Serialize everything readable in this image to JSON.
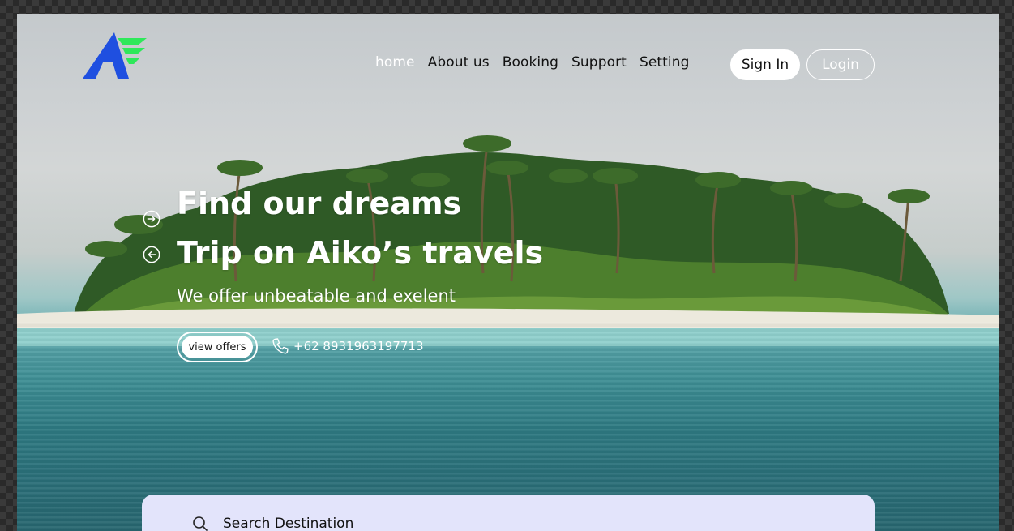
{
  "nav": {
    "items": [
      {
        "label": "home",
        "active": true
      },
      {
        "label": "About us",
        "active": false
      },
      {
        "label": "Booking",
        "active": false
      },
      {
        "label": "Support",
        "active": false
      },
      {
        "label": "Setting",
        "active": false
      }
    ]
  },
  "auth": {
    "signin_label": "Sign In",
    "login_label": "Login"
  },
  "hero": {
    "title_line1": "Find our dreams",
    "title_line2": "Trip on Aiko’s travels",
    "subtitle": "We offer unbeatable and exelent",
    "offers_label": "view offers",
    "phone": "+62 8931963197713"
  },
  "search": {
    "label": "Search Destination"
  },
  "icons": {
    "logo": "aiko-logo",
    "next": "arrow-right-circle-icon",
    "prev": "arrow-left-circle-icon",
    "phone": "phone-icon",
    "search": "search-icon"
  },
  "colors": {
    "logo_blue": "#1f4fe0",
    "logo_green": "#2ee85a",
    "search_bg": "#e3e4fb"
  }
}
